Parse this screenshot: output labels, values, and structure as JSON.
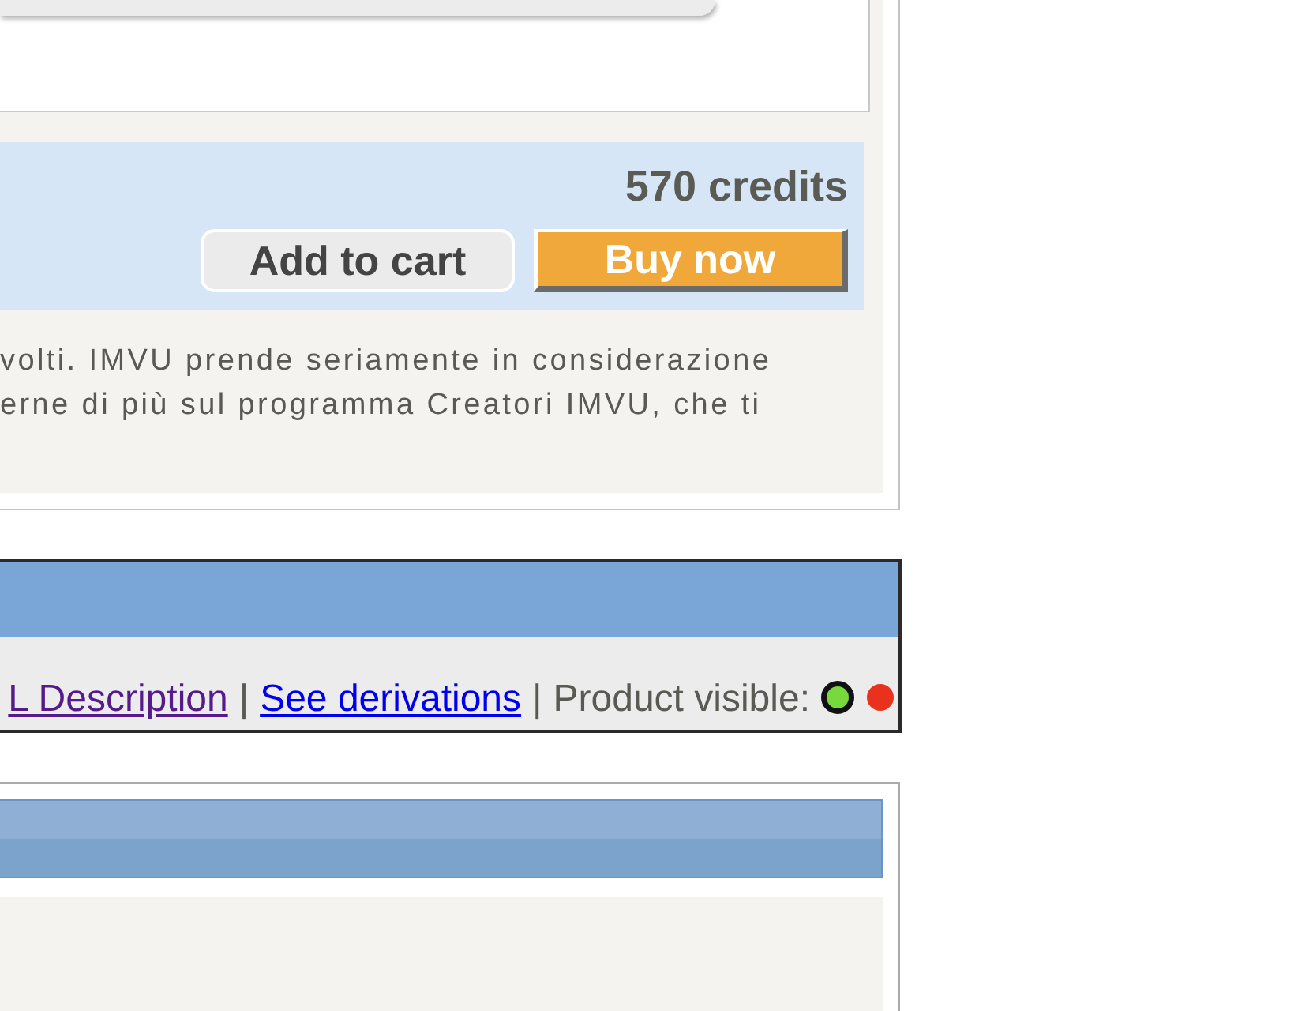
{
  "product_panel": {
    "price": "570 credits",
    "buttons": [
      {
        "label": "Add to cart",
        "kind": "secondary"
      },
      {
        "label": "Buy now",
        "kind": "primary"
      }
    ],
    "description_lines": [
      "volti. IMVU prende seriamente in considerazione",
      "erne di più sul programma Creatori IMVU, che ti"
    ]
  },
  "links_panel": {
    "items": [
      {
        "kind": "link",
        "text": "L Description",
        "visited": true
      },
      {
        "kind": "separator",
        "text": "|"
      },
      {
        "kind": "link",
        "text": "See derivations",
        "visited": false
      },
      {
        "kind": "separator",
        "text": "|"
      },
      {
        "kind": "label",
        "text": "Product visible:"
      }
    ],
    "visibility_options": [
      {
        "color": "#78d83c",
        "selected": true
      },
      {
        "color": "#e8321e",
        "selected": false
      }
    ]
  }
}
